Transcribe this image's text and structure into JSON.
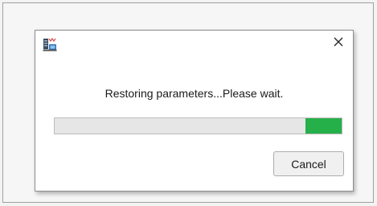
{
  "dialog": {
    "icon": "app-network-icon",
    "close_icon": "close-icon",
    "message": "Restoring parameters...Please wait.",
    "progress": {
      "fill_start": 0.875,
      "fill_end": 1.0,
      "fill_color": "#26b04a",
      "track_color": "#e6e6e6"
    },
    "cancel_label": "Cancel"
  }
}
